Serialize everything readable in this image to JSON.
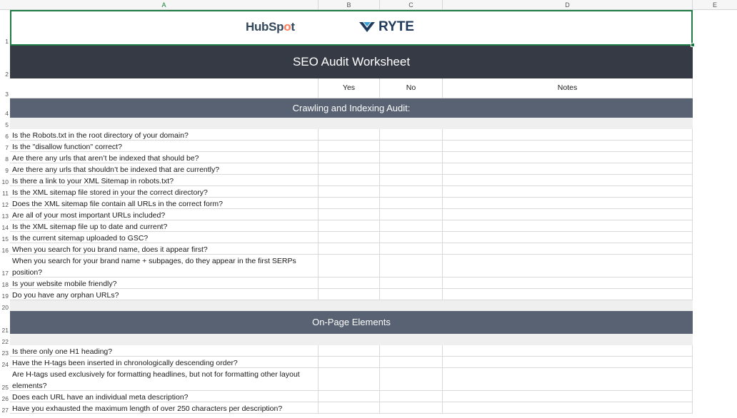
{
  "columns": [
    "A",
    "B",
    "C",
    "D",
    "E"
  ],
  "row_numbers": [
    "1",
    "2",
    "3",
    "4",
    "5",
    "6",
    "7",
    "8",
    "9",
    "10",
    "11",
    "12",
    "13",
    "14",
    "15",
    "16",
    "17",
    "18",
    "19",
    "20",
    "21",
    "22",
    "23",
    "24",
    "25",
    "26",
    "27"
  ],
  "logos": {
    "hubspot_pre": "HubSp",
    "hubspot_spot": "o",
    "hubspot_post": "t",
    "ryte": "RYTE"
  },
  "title": "SEO Audit Worksheet",
  "headers": {
    "yes": "Yes",
    "no": "No",
    "notes": "Notes"
  },
  "sections": [
    {
      "title": "Crawling and Indexing Audit:",
      "questions": [
        "Is the Robots.txt in the root directory of your domain?",
        "Is the \"disallow function\" correct?",
        "Are there any urls that aren’t be indexed that should be?",
        "Are there any urls that shouldn’t be indexed that are currently?",
        "Is there a link to your XML Sitemap in robots.txt?",
        "Is the XML sitemap file stored in your the correct directory?",
        "Does the XML sitemap file contain all URLs in the correct form?",
        "Are all of your most important URLs included?",
        "Is the XML sitemap file up to date and current?",
        "Is the current sitemap uploaded to GSC?",
        "When you search for you brand name, does it appear first?",
        "When you search for your brand name + subpages, do they appear in the first SERPs position?",
        "Is your website mobile friendly?",
        "Do you have any orphan URLs?"
      ]
    },
    {
      "title": "On-Page Elements",
      "questions": [
        "Is there only one H1 heading?",
        "Have the H-tags been inserted in chronologically descending order?",
        "Are H-tags used exclusively for formatting headlines, but not for formatting other layout elements?",
        "Does each URL have an individual meta description?",
        "Have you exhausted the maximum length of over 250 characters per description?"
      ]
    }
  ],
  "colors": {
    "title_bg": "#353a45",
    "section_bg": "#586273",
    "selection": "#1f7a45",
    "hubspot_orange": "#ff7a59",
    "ryte_navy": "#1f3a5a"
  }
}
